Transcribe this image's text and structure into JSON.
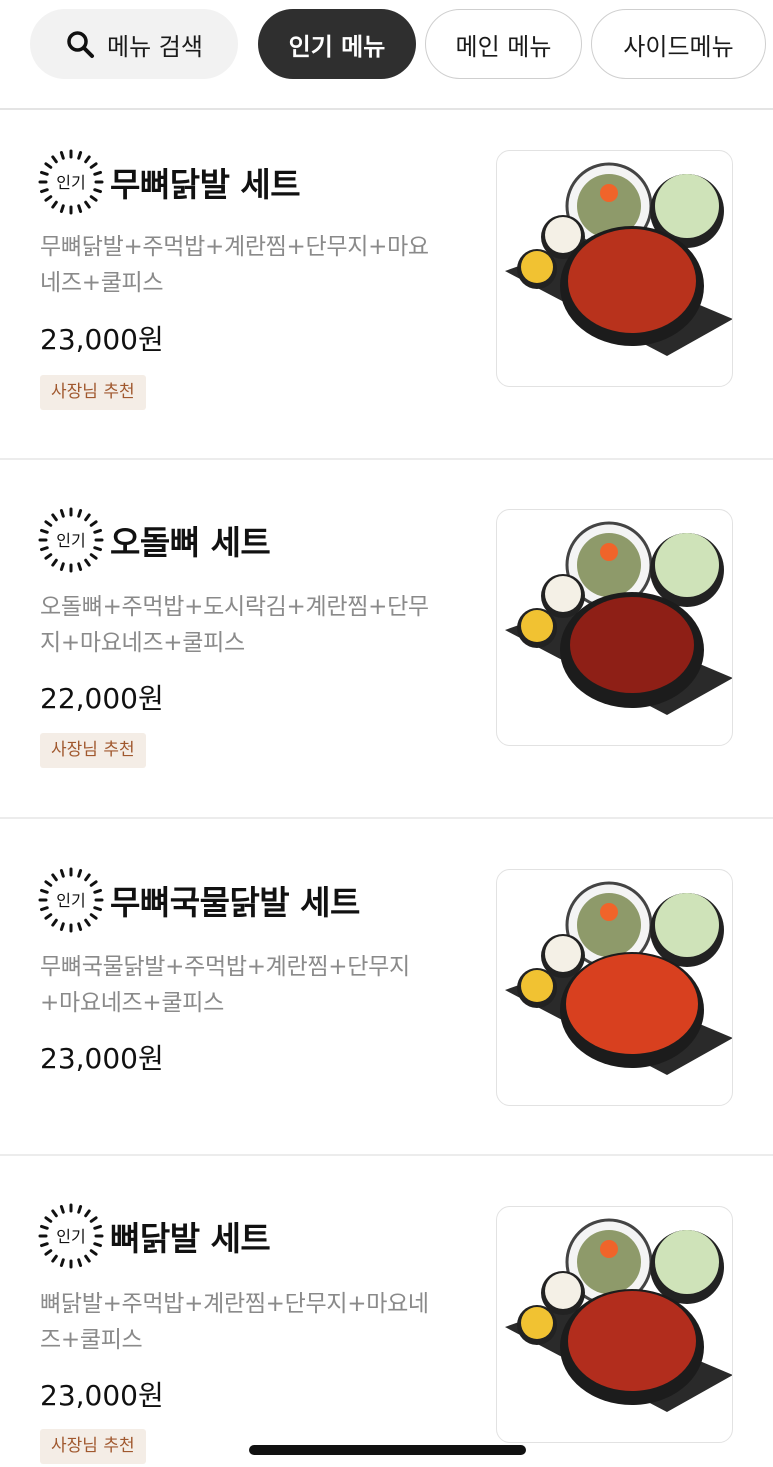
{
  "tabs": {
    "search_label": "메뉴 검색",
    "popular_label": "인기 메뉴",
    "main_label": "메인 메뉴",
    "side_label": "사이드메뉴"
  },
  "popular_badge_text": "인기",
  "items": [
    {
      "name": "무뼈닭발 세트",
      "desc_line1": "무뼈닭발+주먹밥+계란찜+단무지+마요",
      "desc_line2": "네즈+쿨피스",
      "price": "23,000원",
      "recommend": "사장님 추천",
      "dish_color": "#b8321c"
    },
    {
      "name": "오돌뼈 세트",
      "desc_line1": "오돌뼈+주먹밥+도시락김+계란찜+단무",
      "desc_line2": "지+마요네즈+쿨피스",
      "price": "22,000원",
      "recommend": "사장님 추천",
      "dish_color": "#8e1f16"
    },
    {
      "name": "무뼈국물닭발 세트",
      "desc_line1": "무뼈국물닭발+주먹밥+계란찜+단무지",
      "desc_line2": "+마요네즈+쿨피스",
      "price": "23,000원",
      "recommend": "",
      "dish_color": "#d8401f"
    },
    {
      "name": "뼈닭발 세트",
      "desc_line1": "뼈닭발+주먹밥+계란찜+단무지+마요네",
      "desc_line2": "즈+쿨피스",
      "price": "23,000원",
      "recommend": "사장님 추천",
      "dish_color": "#b22d1d"
    }
  ]
}
